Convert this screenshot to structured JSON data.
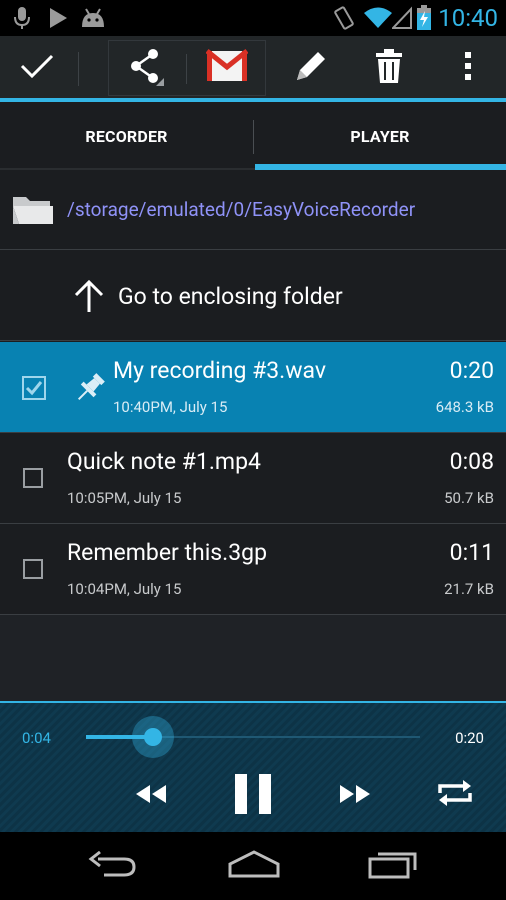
{
  "status_bar": {
    "time": "10:40",
    "left_icons": [
      "microphone-icon",
      "play-icon",
      "android-icon"
    ],
    "right_icons": [
      "vibrate-icon",
      "wifi-icon",
      "signal-icon",
      "battery-charging-icon"
    ]
  },
  "action_bar": {
    "buttons": [
      "done-check-icon",
      "share-icon",
      "gmail-icon",
      "pencil-icon",
      "trash-icon",
      "overflow-menu-icon"
    ]
  },
  "tabs": [
    {
      "label": "RECORDER",
      "selected": false
    },
    {
      "label": "PLAYER",
      "selected": true
    }
  ],
  "path": "/storage/emulated/0/EasyVoiceRecorder",
  "up_label": "Go to enclosing folder",
  "files": [
    {
      "name": "My recording #3.wav",
      "date": "10:40PM, July 15",
      "duration": "0:20",
      "size": "648.3 kB",
      "checked": true,
      "pinned": true
    },
    {
      "name": "Quick note #1.mp4",
      "date": "10:05PM, July 15",
      "duration": "0:08",
      "size": "50.7 kB",
      "checked": false,
      "pinned": false
    },
    {
      "name": "Remember this.3gp",
      "date": "10:04PM, July 15",
      "duration": "0:11",
      "size": "21.7 kB",
      "checked": false,
      "pinned": false
    }
  ],
  "player": {
    "elapsed": "0:04",
    "total": "0:20",
    "progress_fraction": 0.2,
    "controls": [
      "rewind-icon",
      "pause-icon",
      "fast-forward-icon",
      "repeat-icon"
    ]
  },
  "nav_bar": [
    "back-icon",
    "home-icon",
    "recent-apps-icon"
  ],
  "colors": {
    "accent": "#33b5e5",
    "selected_row": "#0882b2",
    "path_text": "#8f92f7",
    "background": "#1b1d20"
  }
}
